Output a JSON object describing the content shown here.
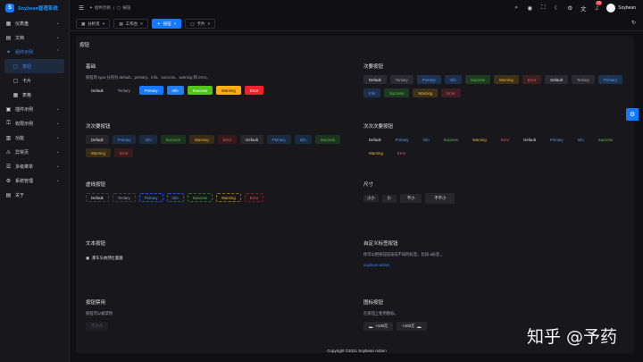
{
  "app": {
    "title": "Soybean管理系统",
    "logo_char": "S"
  },
  "sidebar": {
    "items": [
      {
        "label": "仪表盘",
        "icon": "dashboard-icon",
        "glyph": "▦",
        "chev": "⌄"
      },
      {
        "label": "文档",
        "icon": "document-icon",
        "glyph": "▤",
        "chev": "⌄"
      },
      {
        "label": "组件示例",
        "icon": "component-icon",
        "glyph": "✦",
        "chev": "⌃"
      },
      {
        "label": "按钮",
        "icon": "button-icon",
        "glyph": "▢"
      },
      {
        "label": "卡片",
        "icon": "card-icon",
        "glyph": "▢"
      },
      {
        "label": "表格",
        "icon": "table-icon",
        "glyph": "▦"
      },
      {
        "label": "插件示例",
        "icon": "plugin-icon",
        "glyph": "▣",
        "chev": "⌄"
      },
      {
        "label": "权限示例",
        "icon": "permission-icon",
        "glyph": "⚿",
        "chev": "⌄"
      },
      {
        "label": "功能",
        "icon": "function-icon",
        "glyph": "▥",
        "chev": "⌄"
      },
      {
        "label": "异常页",
        "icon": "exception-icon",
        "glyph": "⚠",
        "chev": "⌄"
      },
      {
        "label": "多级菜单",
        "icon": "multi-menu-icon",
        "glyph": "☰",
        "chev": "⌄"
      },
      {
        "label": "系统管理",
        "icon": "system-icon",
        "glyph": "⚙",
        "chev": "⌄"
      },
      {
        "label": "关于",
        "icon": "about-icon",
        "glyph": "▤"
      }
    ]
  },
  "header": {
    "breadcrumb": [
      {
        "label": "组件示例",
        "icon": "component-icon",
        "glyph": "✦"
      },
      {
        "label": "按钮",
        "icon": "button-icon",
        "glyph": "▢"
      }
    ],
    "separator": "/",
    "user": "Soybean",
    "notify_count": "16",
    "icons": [
      {
        "name": "search-icon",
        "glyph": "⌕"
      },
      {
        "name": "github-icon",
        "glyph": "◉"
      },
      {
        "name": "fullscreen-icon",
        "glyph": "⛶"
      },
      {
        "name": "theme-icon",
        "glyph": "☾"
      },
      {
        "name": "settings-icon",
        "glyph": "⚙"
      },
      {
        "name": "language-icon",
        "glyph": "文"
      }
    ]
  },
  "tabs": [
    {
      "label": "分析页",
      "glyph": "▦",
      "close": "×",
      "active": false
    },
    {
      "label": "工作台",
      "glyph": "▤",
      "close": "×",
      "active": false
    },
    {
      "label": "按钮",
      "glyph": "✦",
      "close": "×",
      "active": true
    },
    {
      "label": "卡片",
      "glyph": "▢",
      "close": "×",
      "active": false
    }
  ],
  "content_title": "按钮",
  "sections": {
    "basic": {
      "title": "基础",
      "desc": "按钮的 type 分别为 default、primary、info、success、warning 和 error。",
      "buttons": [
        "Default",
        "Tertiary",
        "Primary",
        "Info",
        "Success",
        "Warning",
        "Error"
      ]
    },
    "secondary": {
      "title": "次要按钮",
      "buttons": [
        "Default",
        "Tertiary",
        "Primary",
        "Info",
        "Success",
        "Warning",
        "Error",
        "Default",
        "Tertiary",
        "Primary",
        "Info",
        "Success",
        "Warning",
        "Error"
      ]
    },
    "tertiary": {
      "title": "次次要按钮",
      "buttons": [
        "Default",
        "Primary",
        "Info",
        "Success",
        "Warning",
        "Error",
        "Default",
        "Primary",
        "Info",
        "Success",
        "Warning",
        "Error"
      ]
    },
    "quaternary": {
      "title": "次次次要按钮",
      "buttons": [
        "Default",
        "Primary",
        "Info",
        "Success",
        "Warning",
        "Error",
        "Default",
        "Primary",
        "Info",
        "Success",
        "Warning",
        "Error"
      ]
    },
    "dashed": {
      "title": "虚线按钮",
      "buttons": [
        "Default",
        "Tertiary",
        "Primary",
        "Info",
        "Success",
        "Warning",
        "Error"
      ]
    },
    "size": {
      "title": "尺寸",
      "buttons": [
        "小小",
        "小",
        "不小",
        "不不小"
      ]
    },
    "text": {
      "title": "文本按钮",
      "button": "那车头依然吐着烟",
      "icon_glyph": "▣"
    },
    "custom": {
      "title": "自定义标签按钮",
      "desc": "你可以把按钮渲染成不同的标签，比如 a标签 。",
      "link": "soybean-admin"
    },
    "disabled": {
      "title": "按钮禁用",
      "desc": "按钮可以被禁用",
      "button": "不许点"
    },
    "icon": {
      "title": "图标按钮",
      "desc": "在按钮上使用图标。",
      "buttons": [
        {
          "label": "+100元",
          "glyph": "▬",
          "icon": "cash-icon",
          "icon_first": true
        },
        {
          "label": "+100元",
          "glyph": "▬",
          "icon": "cash-icon",
          "icon_first": false
        }
      ]
    }
  },
  "footer": "Copyright ©2021 Soybean Admin",
  "watermark": "知乎 @予药",
  "settings_fab_glyph": "⚙",
  "refresh_glyph": "↻"
}
